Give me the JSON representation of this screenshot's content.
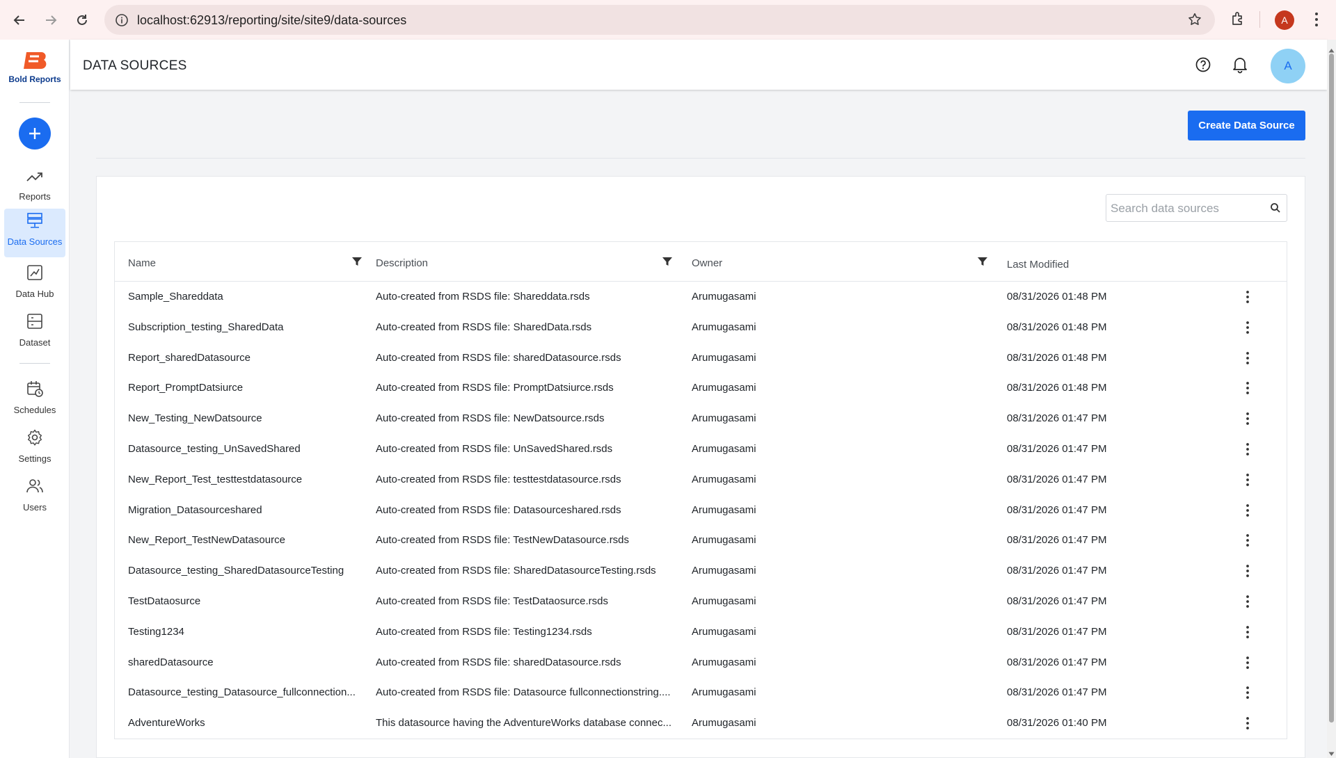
{
  "browser": {
    "url": "localhost:62913/reporting/site/site9/data-sources",
    "profile_initial": "A"
  },
  "sidebar": {
    "brand": "Bold Reports",
    "items": [
      {
        "label": "Reports",
        "icon": "trending-up-icon"
      },
      {
        "label": "Data Sources",
        "icon": "database-icon"
      },
      {
        "label": "Data Hub",
        "icon": "data-hub-icon"
      },
      {
        "label": "Dataset",
        "icon": "dataset-icon"
      },
      {
        "label": "Schedules",
        "icon": "calendar-clock-icon"
      },
      {
        "label": "Settings",
        "icon": "gear-icon"
      },
      {
        "label": "Users",
        "icon": "users-icon"
      }
    ],
    "active": "Data Sources"
  },
  "header": {
    "title": "DATA SOURCES",
    "avatar_initial": "A"
  },
  "toolbar": {
    "create_label": "Create Data Source"
  },
  "search": {
    "placeholder": "Search data sources"
  },
  "table": {
    "columns": [
      "Name",
      "Description",
      "Owner",
      "Last Modified"
    ],
    "rows": [
      {
        "name": "Sample_Shareddata",
        "description": "Auto-created from RSDS file: Shareddata.rsds",
        "owner": "Arumugasami",
        "modified": "08/31/2026 01:48 PM"
      },
      {
        "name": "Subscription_testing_SharedData",
        "description": "Auto-created from RSDS file: SharedData.rsds",
        "owner": "Arumugasami",
        "modified": "08/31/2026 01:48 PM"
      },
      {
        "name": "Report_sharedDatasource",
        "description": "Auto-created from RSDS file: sharedDatasource.rsds",
        "owner": "Arumugasami",
        "modified": "08/31/2026 01:48 PM"
      },
      {
        "name": "Report_PromptDatsiurce",
        "description": "Auto-created from RSDS file: PromptDatsiurce.rsds",
        "owner": "Arumugasami",
        "modified": "08/31/2026 01:48 PM"
      },
      {
        "name": "New_Testing_NewDatsource",
        "description": "Auto-created from RSDS file: NewDatsource.rsds",
        "owner": "Arumugasami",
        "modified": "08/31/2026 01:47 PM"
      },
      {
        "name": "Datasource_testing_UnSavedShared",
        "description": "Auto-created from RSDS file: UnSavedShared.rsds",
        "owner": "Arumugasami",
        "modified": "08/31/2026 01:47 PM"
      },
      {
        "name": "New_Report_Test_testtestdatasource",
        "description": "Auto-created from RSDS file: testtestdatasource.rsds",
        "owner": "Arumugasami",
        "modified": "08/31/2026 01:47 PM"
      },
      {
        "name": "Migration_Datasourceshared",
        "description": "Auto-created from RSDS file: Datasourceshared.rsds",
        "owner": "Arumugasami",
        "modified": "08/31/2026 01:47 PM"
      },
      {
        "name": "New_Report_TestNewDatasource",
        "description": "Auto-created from RSDS file: TestNewDatasource.rsds",
        "owner": "Arumugasami",
        "modified": "08/31/2026 01:47 PM"
      },
      {
        "name": "Datasource_testing_SharedDatasourceTesting",
        "description": "Auto-created from RSDS file: SharedDatasourceTesting.rsds",
        "owner": "Arumugasami",
        "modified": "08/31/2026 01:47 PM"
      },
      {
        "name": "TestDataosurce",
        "description": "Auto-created from RSDS file: TestDataosurce.rsds",
        "owner": "Arumugasami",
        "modified": "08/31/2026 01:47 PM"
      },
      {
        "name": "Testing1234",
        "description": "Auto-created from RSDS file: Testing1234.rsds",
        "owner": "Arumugasami",
        "modified": "08/31/2026 01:47 PM"
      },
      {
        "name": "sharedDatasource",
        "description": "Auto-created from RSDS file: sharedDatasource.rsds",
        "owner": "Arumugasami",
        "modified": "08/31/2026 01:47 PM"
      },
      {
        "name": "Datasource_testing_Datasource_fullconnection...",
        "description": "Auto-created from RSDS file: Datasource fullconnectionstring....",
        "owner": "Arumugasami",
        "modified": "08/31/2026 01:47 PM"
      },
      {
        "name": "AdventureWorks",
        "description": "This datasource having the AdventureWorks database connec...",
        "owner": "Arumugasami",
        "modified": "08/31/2026 01:40 PM"
      }
    ]
  },
  "colors": {
    "accent": "#1a6cf0",
    "brand_orange": "#f05a28",
    "active_nav_bg": "#dbeafe"
  }
}
